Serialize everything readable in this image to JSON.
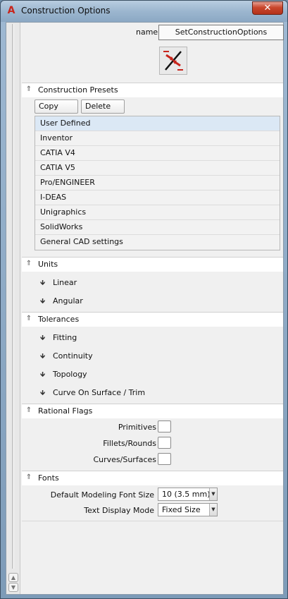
{
  "window": {
    "title": "Construction Options",
    "close_glyph": "✕"
  },
  "header": {
    "name_label": "name",
    "name_value": "SetConstructionOptions",
    "tool_icon": "construction-tool-icon"
  },
  "presets": {
    "title": "Construction Presets",
    "copy_label": "Copy",
    "delete_label": "Delete",
    "items": [
      "User Defined",
      "Inventor",
      "CATIA V4",
      "CATIA V5",
      "Pro/ENGINEER",
      "I-DEAS",
      "Unigraphics",
      "SolidWorks",
      "General CAD settings"
    ],
    "selected_index": 0
  },
  "units": {
    "title": "Units",
    "items": [
      "Linear",
      "Angular"
    ]
  },
  "tolerances": {
    "title": "Tolerances",
    "items": [
      "Fitting",
      "Continuity",
      "Topology",
      "Curve On Surface / Trim"
    ]
  },
  "rational_flags": {
    "title": "Rational Flags",
    "items": [
      "Primitives",
      "Fillets/Rounds",
      "Curves/Surfaces"
    ]
  },
  "fonts": {
    "title": "Fonts",
    "modeling_font_label": "Default Modeling Font Size",
    "modeling_font_value": "10 (3.5 mm)",
    "text_display_label": "Text Display Mode",
    "text_display_value": "Fixed Size"
  },
  "colors": {
    "accent": "#c8251c",
    "selection": "#dbe8f5"
  }
}
